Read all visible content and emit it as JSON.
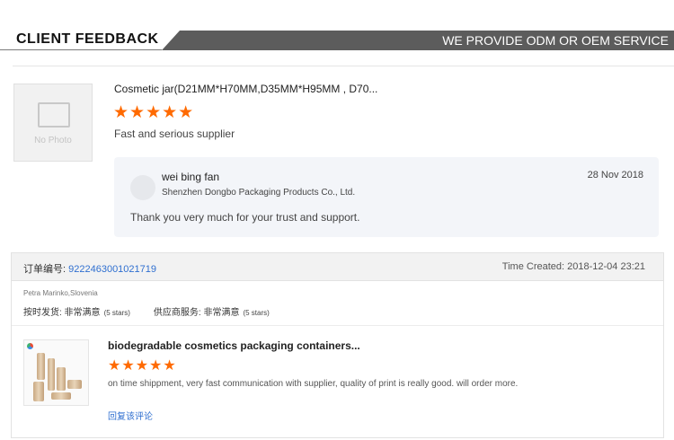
{
  "banner": {
    "title": "CLIENT FEEDBACK",
    "subtitle": "WE PROVIDE ODM OR OEM SERVICE"
  },
  "review1": {
    "thumb_text": "No Photo",
    "thumb_icon": "image-placeholder-icon",
    "product_title": "Cosmetic jar(D21MM*H70MM,D35MM*H95MM , D70...",
    "rating": 5,
    "stars": "★★★★★",
    "comment": "Fast and serious supplier",
    "reply": {
      "name": "wei bing fan",
      "company": "Shenzhen Dongbo Packaging Products Co., Ltd.",
      "date": "28 Nov 2018",
      "text": "Thank you very much for your trust and support."
    }
  },
  "order": {
    "number_label": "订单编号: ",
    "number": "9222463001021719",
    "time_created": "Time Created: 2018-12-04 23:21",
    "buyer": "Petra Marinko,Slovenia",
    "ratings": [
      {
        "label": "按时发货: 非常满意",
        "stars": "(5 stars)"
      },
      {
        "label": "供应商服务: 非常满意",
        "stars": "(5 stars)"
      }
    ],
    "product_title": "biodegradable cosmetics packaging containers...",
    "rating": 5,
    "stars": "★★★★★",
    "comment": "on time shippment, very fast communication with supplier, quality of print is really good. will order more.",
    "reply_link": "回复该评论"
  },
  "colors": {
    "accent_star": "#ff6a00",
    "link": "#2f6fd0",
    "banner_bg": "#5c5c5c"
  }
}
